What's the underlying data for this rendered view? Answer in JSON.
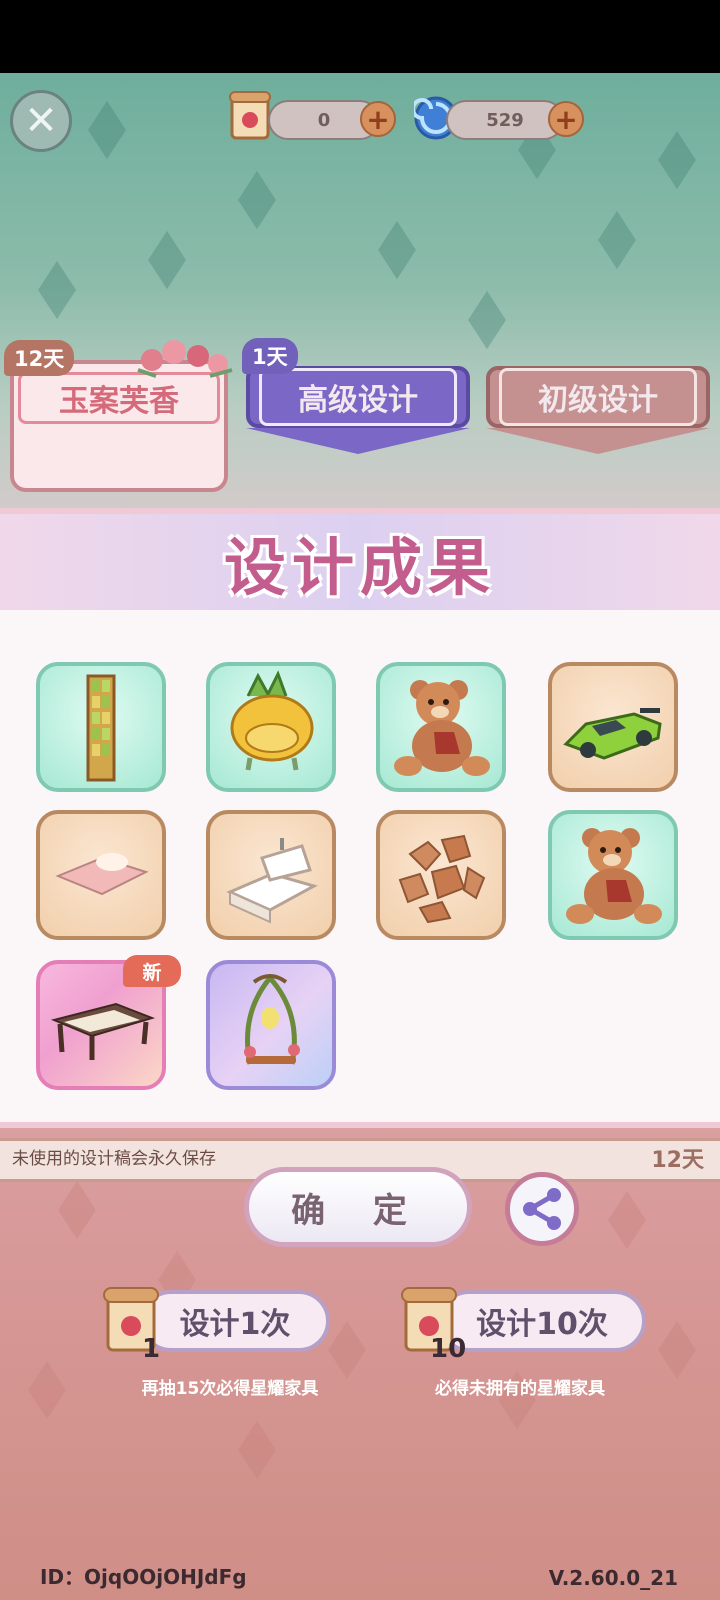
{
  "header": {
    "ticket_count": "0",
    "gem_count": "529"
  },
  "tabs": [
    {
      "badge": "12天",
      "label": "玉案芙香"
    },
    {
      "badge": "1天",
      "label": "高级设计"
    },
    {
      "label": "初级设计"
    }
  ],
  "dialog": {
    "title": "设计成果",
    "items": [
      {
        "name": "window-screen",
        "rarity": "green"
      },
      {
        "name": "pineapple-armchair",
        "rarity": "green"
      },
      {
        "name": "teddy-bear",
        "rarity": "green"
      },
      {
        "name": "green-sports-car",
        "rarity": "tan"
      },
      {
        "name": "pink-rug",
        "rarity": "tan"
      },
      {
        "name": "bathtub",
        "rarity": "tan"
      },
      {
        "name": "stone-path",
        "rarity": "tan"
      },
      {
        "name": "teddy-bear",
        "rarity": "green"
      },
      {
        "name": "carved-table",
        "rarity": "pink",
        "badge": "新"
      },
      {
        "name": "bird-swing",
        "rarity": "purple"
      }
    ],
    "confirm_label": "确 定"
  },
  "hint": {
    "text": "未使用的设计稿会永久保存",
    "days": "12天"
  },
  "draw_buttons": [
    {
      "label": "设计1次",
      "count": "1",
      "subtitle": "再抽15次必得星耀家具"
    },
    {
      "label": "设计10次",
      "count": "10",
      "subtitle": "必得未拥有的星耀家具"
    }
  ],
  "footer": {
    "id": "ID：OjqOOjOHJdFg",
    "version": "V.2.60.0_21"
  },
  "colors": {
    "title": "#c25d8d",
    "green_tile": "#a6e8d3",
    "tan_tile": "#f1cfab",
    "new_badge": "#e36b58"
  }
}
